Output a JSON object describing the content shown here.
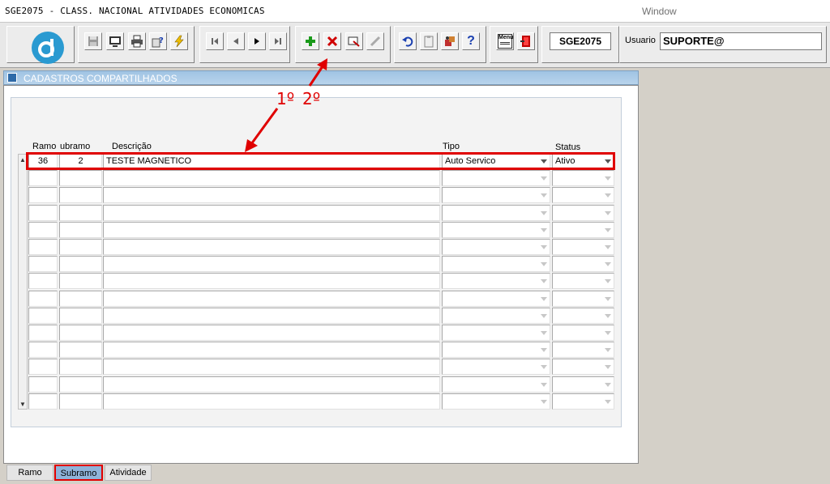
{
  "window": {
    "title": "SGE2075 - CLASS. NACIONAL ATIVIDADES ECONOMICAS",
    "menu": "Window"
  },
  "toolbar": {
    "logo_letter": "d",
    "buttons": [
      {
        "name": "save-button",
        "icon": "floppy-icon"
      },
      {
        "name": "print-screen-button",
        "icon": "monitor-icon"
      },
      {
        "name": "print-button",
        "icon": "printer-icon"
      },
      {
        "name": "query-button",
        "icon": "query-icon"
      },
      {
        "name": "execute-query-button",
        "icon": "lightning-icon"
      },
      {
        "name": "first-record-button",
        "icon": "first-icon"
      },
      {
        "name": "previous-record-button",
        "icon": "previous-icon"
      },
      {
        "name": "next-record-button",
        "icon": "next-icon"
      },
      {
        "name": "last-record-button",
        "icon": "last-icon"
      },
      {
        "name": "insert-record-button",
        "icon": "plus-icon"
      },
      {
        "name": "delete-record-button",
        "icon": "x-icon"
      },
      {
        "name": "duplicate-record-button",
        "icon": "duplicate-icon"
      },
      {
        "name": "edit-button",
        "icon": "pencil-icon"
      },
      {
        "name": "undo-button",
        "icon": "undo-icon"
      },
      {
        "name": "clipboard-button",
        "icon": "clipboard-icon"
      },
      {
        "name": "tools-button",
        "icon": "tools-icon"
      },
      {
        "name": "help-button",
        "icon": "question-icon"
      },
      {
        "name": "menu-button",
        "icon": "menu-icon"
      },
      {
        "name": "exit-button",
        "icon": "exit-door-icon"
      }
    ],
    "menu_label": "Menu",
    "help_glyph": "?",
    "form_id": "SGE2075",
    "user_label": "Usuario",
    "user_value": "SUPORTE@"
  },
  "form": {
    "title": "CADASTROS COMPARTILHADOS",
    "columns": {
      "ramo": "Ramo",
      "subramo": "ubramo",
      "descricao": "Descrição",
      "tipo": "Tipo",
      "status": "Status"
    },
    "rows": [
      {
        "ramo": "36",
        "subramo": "2",
        "descricao": "TESTE MAGNETICO",
        "tipo": "Auto Servico",
        "status": "Ativo"
      },
      {
        "ramo": "",
        "subramo": "",
        "descricao": "",
        "tipo": "",
        "status": ""
      },
      {
        "ramo": "",
        "subramo": "",
        "descricao": "",
        "tipo": "",
        "status": ""
      },
      {
        "ramo": "",
        "subramo": "",
        "descricao": "",
        "tipo": "",
        "status": ""
      },
      {
        "ramo": "",
        "subramo": "",
        "descricao": "",
        "tipo": "",
        "status": ""
      },
      {
        "ramo": "",
        "subramo": "",
        "descricao": "",
        "tipo": "",
        "status": ""
      },
      {
        "ramo": "",
        "subramo": "",
        "descricao": "",
        "tipo": "",
        "status": ""
      },
      {
        "ramo": "",
        "subramo": "",
        "descricao": "",
        "tipo": "",
        "status": ""
      },
      {
        "ramo": "",
        "subramo": "",
        "descricao": "",
        "tipo": "",
        "status": ""
      },
      {
        "ramo": "",
        "subramo": "",
        "descricao": "",
        "tipo": "",
        "status": ""
      },
      {
        "ramo": "",
        "subramo": "",
        "descricao": "",
        "tipo": "",
        "status": ""
      },
      {
        "ramo": "",
        "subramo": "",
        "descricao": "",
        "tipo": "",
        "status": ""
      },
      {
        "ramo": "",
        "subramo": "",
        "descricao": "",
        "tipo": "",
        "status": ""
      },
      {
        "ramo": "",
        "subramo": "",
        "descricao": "",
        "tipo": "",
        "status": ""
      },
      {
        "ramo": "",
        "subramo": "",
        "descricao": "",
        "tipo": "",
        "status": ""
      }
    ],
    "tabs": [
      {
        "label": "Ramo",
        "active": false
      },
      {
        "label": "Subramo",
        "active": true
      },
      {
        "label": "Atividade",
        "active": false
      }
    ]
  },
  "annotations": {
    "step1": "1º",
    "step2": "2º",
    "highlight_color": "#e00000"
  },
  "colors": {
    "header_blue": "#9fc3e3",
    "logo_blue": "#2a9ad1",
    "active_tab": "#8fb3d9"
  }
}
